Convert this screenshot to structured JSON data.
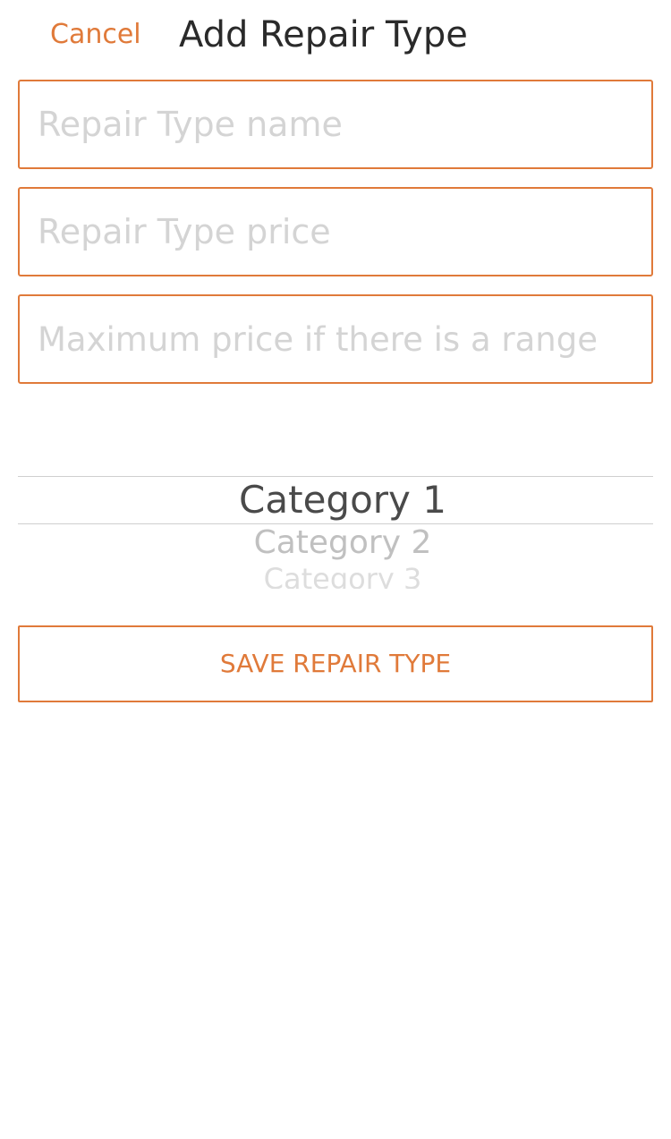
{
  "header": {
    "cancel_label": "Cancel",
    "title": "Add Repair Type"
  },
  "form": {
    "name_placeholder": "Repair Type name",
    "price_placeholder": "Repair Type price",
    "max_price_placeholder": "Maximum price if there is a range"
  },
  "category_picker": {
    "items": [
      "Category 1",
      "Category 2",
      "Category 3"
    ],
    "selected": "Category 1"
  },
  "save_label": "SAVE REPAIR TYPE",
  "colors": {
    "accent": "#e07a3a",
    "title_text": "#2a2a2a",
    "placeholder": "#d4d4d4",
    "picker_selected": "#4a4a4a"
  }
}
